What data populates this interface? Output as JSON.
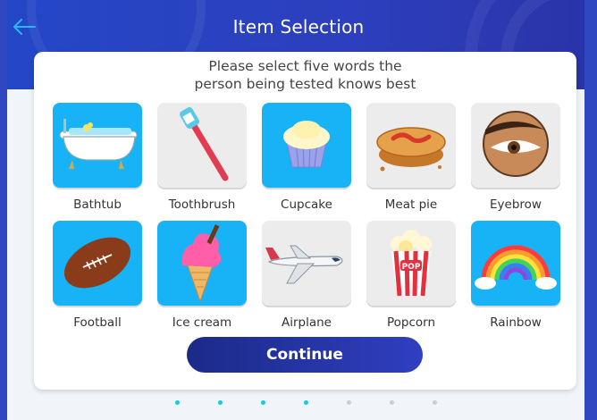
{
  "header": {
    "title": "Item Selection",
    "back_icon": "arrow-left-icon"
  },
  "instructions": {
    "line1": "Please select five words the",
    "line2": "person being tested knows best"
  },
  "items": [
    {
      "label": "Bathtub",
      "icon": "bathtub-icon",
      "selected": true
    },
    {
      "label": "Toothbrush",
      "icon": "toothbrush-icon",
      "selected": false
    },
    {
      "label": "Cupcake",
      "icon": "cupcake-icon",
      "selected": true
    },
    {
      "label": "Meat pie",
      "icon": "meat-pie-icon",
      "selected": false
    },
    {
      "label": "Eyebrow",
      "icon": "eyebrow-icon",
      "selected": false
    },
    {
      "label": "Football",
      "icon": "football-icon",
      "selected": true
    },
    {
      "label": "Ice cream",
      "icon": "ice-cream-icon",
      "selected": true
    },
    {
      "label": "Airplane",
      "icon": "airplane-icon",
      "selected": false
    },
    {
      "label": "Popcorn",
      "icon": "popcorn-icon",
      "selected": false
    },
    {
      "label": "Rainbow",
      "icon": "rainbow-icon",
      "selected": true
    }
  ],
  "continue_label": "Continue",
  "pagination": {
    "total": 7,
    "active": [
      1,
      2,
      3,
      4
    ]
  },
  "colors": {
    "selected_tile": "#17b3f6",
    "unselected_tile": "#ececec",
    "active_dot": "#1ec6d8",
    "inactive_dot": "#c8ccd4"
  }
}
